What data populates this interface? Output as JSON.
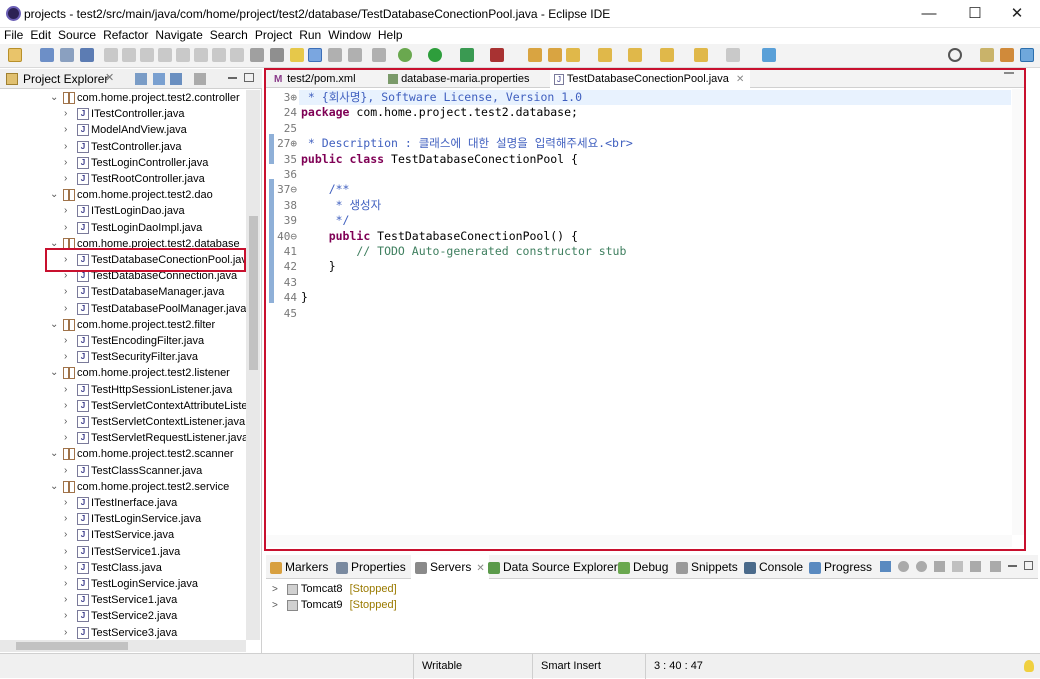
{
  "window": {
    "title": "projects - test2/src/main/java/com/home/project/test2/database/TestDatabaseConectionPool.java - Eclipse IDE",
    "minimize": "—",
    "maximize": "☐",
    "close": "✕"
  },
  "menu": [
    "File",
    "Edit",
    "Source",
    "Refactor",
    "Navigate",
    "Search",
    "Project",
    "Run",
    "Window",
    "Help"
  ],
  "explorer": {
    "title": "Project Explorer",
    "tree": [
      {
        "type": "package",
        "label": "com.home.project.test2.controller"
      },
      {
        "type": "file",
        "label": "ITestController.java"
      },
      {
        "type": "file",
        "label": "ModelAndView.java"
      },
      {
        "type": "file",
        "label": "TestController.java"
      },
      {
        "type": "file",
        "label": "TestLoginController.java"
      },
      {
        "type": "file",
        "label": "TestRootController.java"
      },
      {
        "type": "package",
        "label": "com.home.project.test2.dao"
      },
      {
        "type": "file",
        "label": "ITestLoginDao.java"
      },
      {
        "type": "file",
        "label": "TestLoginDaoImpl.java"
      },
      {
        "type": "package",
        "label": "com.home.project.test2.database"
      },
      {
        "type": "file",
        "label": "TestDatabaseConectionPool.java"
      },
      {
        "type": "file",
        "label": "TestDatabaseConnection.java"
      },
      {
        "type": "file",
        "label": "TestDatabaseManager.java"
      },
      {
        "type": "file",
        "label": "TestDatabasePoolManager.java"
      },
      {
        "type": "package",
        "label": "com.home.project.test2.filter"
      },
      {
        "type": "file",
        "label": "TestEncodingFilter.java"
      },
      {
        "type": "file",
        "label": "TestSecurityFilter.java"
      },
      {
        "type": "package",
        "label": "com.home.project.test2.listener"
      },
      {
        "type": "file",
        "label": "TestHttpSessionListener.java"
      },
      {
        "type": "file",
        "label": "TestServletContextAttributeListe"
      },
      {
        "type": "file",
        "label": "TestServletContextListener.java"
      },
      {
        "type": "file",
        "label": "TestServletRequestListener.java"
      },
      {
        "type": "package",
        "label": "com.home.project.test2.scanner"
      },
      {
        "type": "file",
        "label": "TestClassScanner.java"
      },
      {
        "type": "package",
        "label": "com.home.project.test2.service"
      },
      {
        "type": "file",
        "label": "ITestInerface.java"
      },
      {
        "type": "file",
        "label": "ITestLoginService.java"
      },
      {
        "type": "file",
        "label": "ITestService.java"
      },
      {
        "type": "file",
        "label": "ITestService1.java"
      },
      {
        "type": "file",
        "label": "TestClass.java"
      },
      {
        "type": "file",
        "label": "TestLoginService.java"
      },
      {
        "type": "file",
        "label": "TestService1.java"
      },
      {
        "type": "file",
        "label": "TestService2.java"
      },
      {
        "type": "file",
        "label": "TestService3.java"
      }
    ]
  },
  "editor": {
    "tabs": [
      "test2/pom.xml",
      "database-maria.properties",
      "TestDatabaseConectionPool.java"
    ],
    "lines": [
      {
        "n": "3⊕",
        "text": " * {회사명}, Software License, Version 1.0"
      },
      {
        "n": "24",
        "text": "package com.home.project.test2.database;"
      },
      {
        "n": "25",
        "text": ""
      },
      {
        "n": "27⊕",
        "text": " * Description : 클래스에 대한 설명을 입력해주세요.<br>"
      },
      {
        "n": "35",
        "text": "public class TestDatabaseConectionPool {"
      },
      {
        "n": "36",
        "text": ""
      },
      {
        "n": "37⊖",
        "text": "    /**"
      },
      {
        "n": "38",
        "text": "     * 생성자"
      },
      {
        "n": "39",
        "text": "     */"
      },
      {
        "n": "40⊖",
        "text": "    public TestDatabaseConectionPool() {"
      },
      {
        "n": "41",
        "text": "        // TODO Auto-generated constructor stub"
      },
      {
        "n": "42",
        "text": "    }"
      },
      {
        "n": "43",
        "text": ""
      },
      {
        "n": "44",
        "text": "}"
      },
      {
        "n": "45",
        "text": ""
      }
    ]
  },
  "bottom": {
    "tabs": [
      "Markers",
      "Properties",
      "Servers",
      "Data Source Explorer",
      "Debug",
      "Snippets",
      "Console",
      "Progress"
    ],
    "servers": [
      {
        "name": "Tomcat8",
        "state": "[Stopped]"
      },
      {
        "name": "Tomcat9",
        "state": "[Stopped]"
      }
    ]
  },
  "status": {
    "writable": "Writable",
    "insert": "Smart Insert",
    "position": "3 : 40 : 47"
  }
}
